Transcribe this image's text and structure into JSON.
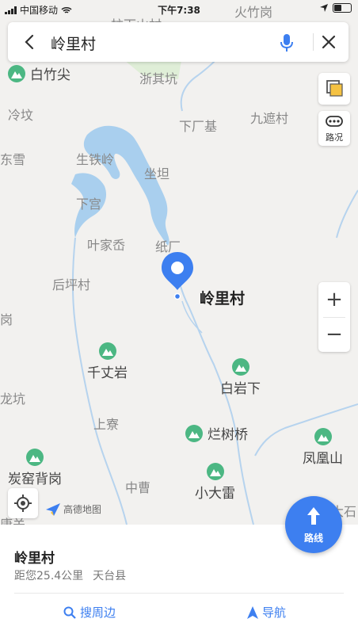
{
  "status_bar": {
    "carrier": "中国移动",
    "time": "下午7:38"
  },
  "search": {
    "query": "岭里村"
  },
  "map": {
    "places": [
      "柱下山村",
      "火竹岗",
      "浙其坑",
      "冷坟",
      "下厂基",
      "九遮村",
      "东雪",
      "生铁岭",
      "坐坦",
      "下宫",
      "叶家岙",
      "纸厂",
      "后坪村",
      "岗",
      "上寮",
      "龙坑",
      "中曹",
      "大石",
      "康关"
    ],
    "pois": [
      "白竹尖",
      "千丈岩",
      "白岩下",
      "烂树桥",
      "凤凰山",
      "炭窑背岗",
      "小大雷"
    ],
    "selected_label": "岭里村",
    "traffic_label": "路况",
    "logo_text": "高德地图",
    "water_color": "#a9cfee",
    "road_color": "#b6d3ee"
  },
  "route_button": {
    "label": "路线"
  },
  "result": {
    "name": "岭里村",
    "distance": "距您25.4公里",
    "region": "天台县"
  },
  "actions": {
    "nearby": "搜周边",
    "navigate": "导航"
  },
  "colors": {
    "accent": "#3d7ff0",
    "poi": "#4cb783"
  }
}
